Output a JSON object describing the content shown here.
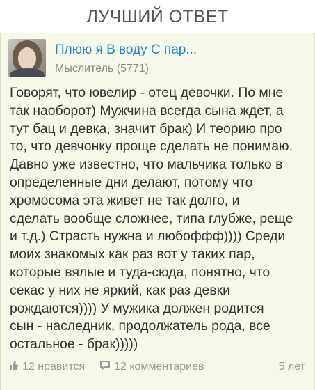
{
  "header": {
    "title": "ЛУЧШИЙ ОТВЕТ"
  },
  "author": {
    "name": "Плюю я В воду С пар...",
    "rank": "Мыслитель (5771)"
  },
  "answer": {
    "text": "Говорят, что ювелир - отец девочки. По мне\nтак наоборот) Мужчина всегда сына ждет, а\nтут бац и девка, значит брак) И теорию про\nто, что девчонку проще сделать не понимаю.\nДавно уже известно, что мальчика только в\nопределенные дни делают, потому что\nхромосома эта живет не так долго, и\nсделать вообще сложнее, типа глубже, реще\nи т.д.) Страсть нужна и любоффф)))) Среди\nмоих знакомых как раз вот у таких пар,\nкоторые вялые и туда-сюда, понятно, что\nсекас у них не яркий, как раз девки\nрождаются)))) У мужика должен родится\nсын - наследник, продолжатель рода, все\nостальное - брак)))))"
  },
  "footer": {
    "likes": "12 нравится",
    "comments": "12 комментариев",
    "time": "5 лет"
  },
  "icons": {
    "like": "thumbs-up-icon",
    "comment": "comment-icon"
  },
  "colors": {
    "card_background": "#f6f9ea",
    "author_name": "#2b7fd0",
    "body_text": "#333333",
    "muted_text": "#9a9a9a"
  }
}
